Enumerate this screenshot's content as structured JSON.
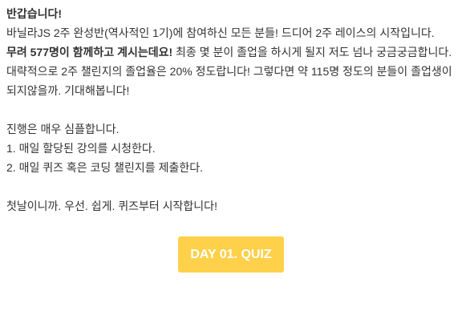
{
  "greeting": "반갑습니다!",
  "intro": "바닐라JS 2주 완성반(역사적인 1기)에 참여하신 모든 분들! 드디어 2주 레이스의 시작입니다.",
  "participants_bold": "무려 577명이 함께하고 계시는데요!",
  "participants_rest": " 최종 몇 분이 졸업을 하시게 될지 저도 넘나 궁금궁금합니다. 대략적으로 2주 챌린지의 졸업율은 20% 정도랍니다! 그렇다면 약 115명 정도의 분들이 졸업생이 되지않을까. 기대해봅니다!",
  "process_title": "진행은 매우 심플합니다.",
  "steps": [
    "1. 매일 할당된 강의를 시청한다.",
    "2. 매일 퀴즈 혹은 코딩 챌린지를 제출한다."
  ],
  "closing": "첫날이니까. 우선. 쉽게. 퀴즈부터 시작합니다!",
  "button_label": "DAY 01. QUIZ",
  "accent_color": "#ffd04a"
}
